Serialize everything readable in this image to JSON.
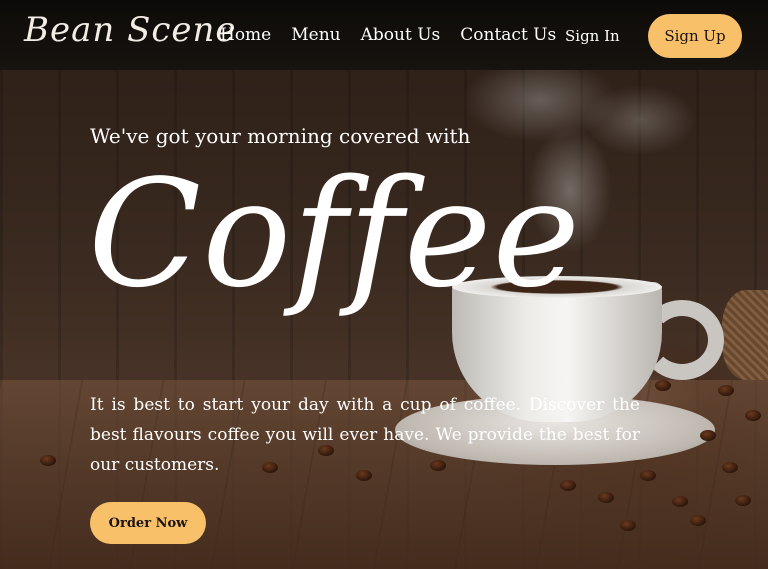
{
  "brand": {
    "logo_text": "Bean Scene"
  },
  "nav": {
    "links": [
      "Home",
      "Menu",
      "About Us",
      "Contact Us"
    ],
    "sign_in": "Sign In",
    "sign_up": "Sign Up"
  },
  "hero": {
    "tagline": "We've got your morning covered with",
    "headline": "Coffee",
    "description": "It is best to start your day with a cup of coffee. Discover the best flavours coffee you will ever have. We provide the best for our customers.",
    "cta_label": "Order Now"
  },
  "colors": {
    "accent": "#f9c06a",
    "navbar_bg": "#0d0b09",
    "text": "#ffffff"
  }
}
